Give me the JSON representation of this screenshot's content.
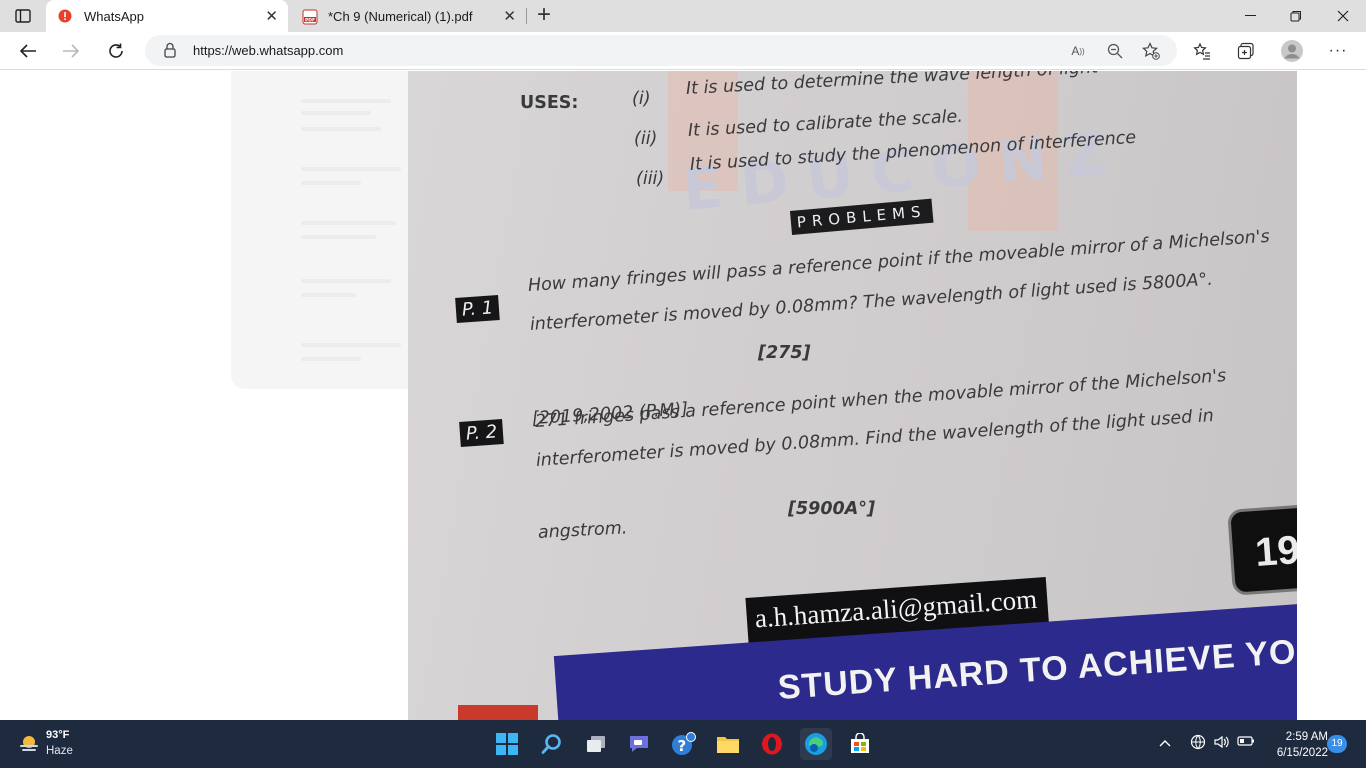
{
  "browser": {
    "tabs": [
      {
        "title": "WhatsApp",
        "active": true,
        "favicon": "whatsapp-alert-icon"
      },
      {
        "title": "*Ch 9 (Numerical) (1).pdf",
        "active": false,
        "favicon": "pdf-icon"
      }
    ],
    "address": {
      "url": "https://web.whatsapp.com"
    }
  },
  "document_photo": {
    "uses_heading": "USES:",
    "uses": [
      {
        "num": "(i)",
        "text": "It is used to determine the wave length of light"
      },
      {
        "num": "(ii)",
        "text": "It is used to calibrate the scale."
      },
      {
        "num": "(iii)",
        "text": "It is used to study the phenomenon of interference"
      }
    ],
    "watermark": "EDUCONZ",
    "problems_heading": "PROBLEMS",
    "problems": [
      {
        "label": "P. 1",
        "lines": [
          "How many fringes will pass a reference point if the moveable mirror of a Michelson's",
          "interferometer is moved by 0.08mm? The wavelength of light used is 5800A°."
        ],
        "answer": "[275]"
      },
      {
        "label": "P. 2",
        "year": "[2019,2002 (P.M)]",
        "lines": [
          "271 fringes pass a reference point when the movable mirror of the Michelson's",
          "interferometer is moved by 0.08mm. Find the wavelength of the light used in",
          "angstrom."
        ],
        "answer": "[5900A°]"
      }
    ],
    "email": "a.h.hamza.ali@gmail.com",
    "page_number": "19",
    "banner": "STUDY HARD TO ACHIEVE YOUR"
  },
  "taskbar": {
    "weather": {
      "temp": "93°F",
      "condition": "Haze"
    },
    "time": "2:59 AM",
    "date": "6/15/2022",
    "notifications": "19"
  },
  "colors": {
    "tabstrip": "#dfdfdf",
    "taskbar": "#1e2a3d",
    "banner": "#2c2a8c"
  }
}
